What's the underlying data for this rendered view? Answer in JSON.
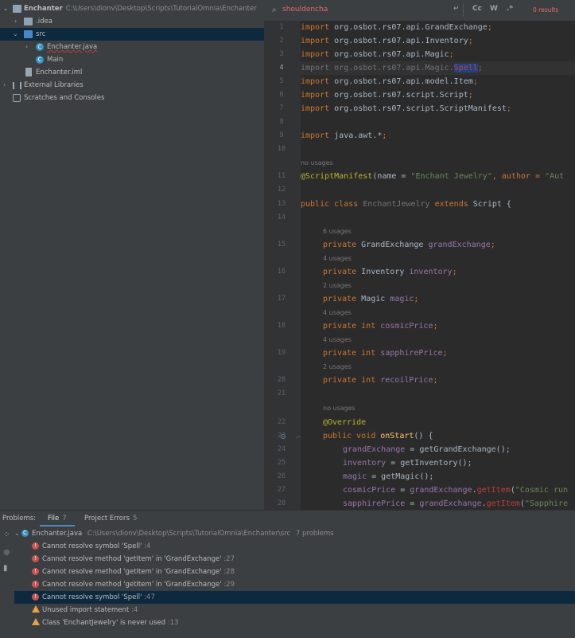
{
  "project_tree": {
    "root_label": "Enchanter",
    "root_path": "C:\\Users\\dionv\\Desktop\\Scripts\\TutorialOmnia\\Enchanter",
    "idea_label": ".idea",
    "src_label": "src",
    "enchanter_java_label": "Enchanter.java",
    "main_label": "Main",
    "iml_label": "Enchanter.iml",
    "ext_libs_label": "External Libraries",
    "scratches_label": "Scratches and Consoles"
  },
  "search": {
    "query": "shouldencha",
    "results": "0 results",
    "case_btn": "Cc",
    "word_btn": "W",
    "regex_btn": ".*"
  },
  "editor": {
    "line_numbers": [
      "1",
      "2",
      "3",
      "4",
      "5",
      "6",
      "7",
      "8",
      "9",
      "10",
      "11",
      "12",
      "13",
      "14",
      "15",
      "16",
      "17",
      "18",
      "19",
      "20",
      "21",
      "22",
      "23",
      "24",
      "25",
      "26",
      "27",
      "28"
    ],
    "hints": {
      "h11": "no usages",
      "h15": "6 usages",
      "h16": "4 usages",
      "h17": "2 usages",
      "h18": "4 usages",
      "h19": "4 usages",
      "h20": "2 usages",
      "h22": "no usages"
    },
    "code": {
      "l1a": "import ",
      "l1b": "org.osbot.rs07.api.GrandExchange",
      "l1c": ";",
      "l2a": "import ",
      "l2b": "org.osbot.rs07.api.Inventory",
      "l2c": ";",
      "l3a": "import ",
      "l3b": "org.osbot.rs07.api.Magic",
      "l3c": ";",
      "l4a": "import org.osbot.rs07.api.Magic.",
      "l4b": "Spell",
      "l4c": ";",
      "l5a": "import ",
      "l5b": "org.osbot.rs07.api.model.Item",
      "l5c": ";",
      "l6a": "import ",
      "l6b": "org.osbot.rs07.script.Script",
      "l6c": ";",
      "l7a": "import ",
      "l7b": "org.osbot.rs07.script.ScriptManifest",
      "l7c": ";",
      "l9a": "import ",
      "l9b": "java.awt.*",
      "l9c": ";",
      "l11a": "@ScriptManifest",
      "l11b": "(name = ",
      "l11c": "\"Enchant Jewelry\"",
      "l11d": ", author = ",
      "l11e": "\"Aut",
      "l13a": "public class ",
      "l13b": "EnchantJewelry",
      "l13c": " extends ",
      "l13d": "Script {",
      "l15a": "private ",
      "l15b": "GrandExchange ",
      "l15c": "grandExchange",
      "l15d": ";",
      "l16a": "private ",
      "l16b": "Inventory ",
      "l16c": "inventory",
      "l16d": ";",
      "l17a": "private ",
      "l17b": "Magic ",
      "l17c": "magic",
      "l17d": ";",
      "l18a": "private int ",
      "l18b": "cosmicPrice",
      "l18c": ";",
      "l19a": "private int ",
      "l19b": "sapphirePrice",
      "l19c": ";",
      "l20a": "private int ",
      "l20b": "recoilPrice",
      "l20c": ";",
      "l22a": "@Override",
      "l23a": "public void ",
      "l23b": "onStart",
      "l23c": "() {",
      "l24a": "grandExchange",
      "l24b": " = getGrandExchange();",
      "l25a": "inventory",
      "l25b": " = getInventory();",
      "l26a": "magic",
      "l26b": " = getMagic();",
      "l27a": "cosmicPrice",
      "l27b": " = ",
      "l27c": "grandExchange",
      "l27d": ".",
      "l27e": "getItem",
      "l27f": "(",
      "l27g": "\"Cosmic run",
      "l28a": "sapphirePrice",
      "l28b": " = ",
      "l28c": "grandExchange",
      "l28d": ".",
      "l28e": "getItem",
      "l28f": "(",
      "l28g": "\"Sapphire"
    }
  },
  "problems": {
    "title": "Problems:",
    "tab_file": "File",
    "tab_file_count": "7",
    "tab_project": "Project Errors",
    "tab_project_count": "5",
    "file_row": {
      "name": "Enchanter.java",
      "path": "C:\\Users\\dionv\\Desktop\\Scripts\\TutorialOmnia\\Enchanter\\src",
      "count": "7 problems"
    },
    "items": [
      {
        "text": "Cannot resolve symbol 'Spell'",
        "loc": ":4",
        "severity": "error"
      },
      {
        "text": "Cannot resolve method 'getItem' in 'GrandExchange'",
        "loc": ":27",
        "severity": "error"
      },
      {
        "text": "Cannot resolve method 'getItem' in 'GrandExchange'",
        "loc": ":28",
        "severity": "error"
      },
      {
        "text": "Cannot resolve method 'getItem' in 'GrandExchange'",
        "loc": ":29",
        "severity": "error"
      },
      {
        "text": "Cannot resolve symbol 'Spell'",
        "loc": ":47",
        "severity": "error"
      },
      {
        "text": "Unused import statement",
        "loc": ":4",
        "severity": "warning"
      },
      {
        "text": "Class 'EnchantJewelry' is never used",
        "loc": ":13",
        "severity": "warning"
      }
    ]
  }
}
